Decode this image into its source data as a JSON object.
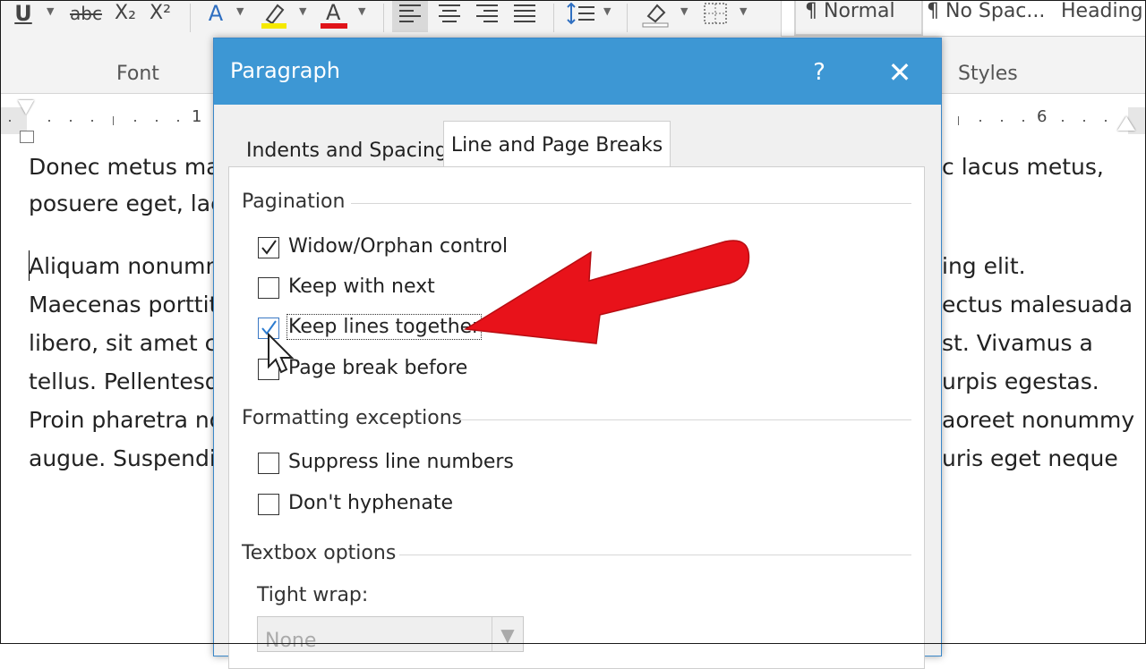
{
  "ribbon": {
    "font_group_label": "Font",
    "styles_group_label": "Styles",
    "font_tools": [
      "U",
      "abc",
      "X₂",
      "X²",
      "A",
      "A"
    ],
    "styles": [
      "¶ Normal",
      "¶ No Spac...",
      "Heading"
    ]
  },
  "ruler": {
    "labels": [
      "1",
      "6"
    ]
  },
  "document": {
    "lines": [
      "Donec metus mas",
      "posuere eget, laci",
      "Aliquam nonumm",
      "Maecenas porttit",
      "libero, sit amet c",
      "tellus. Pellentesqu",
      "Proin pharetra no",
      "augue. Suspendis"
    ],
    "right_lines": [
      "c lacus metus,",
      "ing elit.",
      "ectus malesuada",
      "st. Vivamus a",
      "urpis egestas.",
      "aoreet nonummy",
      "uris eget neque"
    ]
  },
  "dialog": {
    "title": "Paragraph",
    "help": "?",
    "close": "✕",
    "tabs": {
      "indents": "Indents and Spacing",
      "line_breaks": "Line and Page Breaks"
    },
    "pagination": {
      "label": "Pagination",
      "widow_orphan": "Widow/Orphan control",
      "widow_orphan_checked": true,
      "keep_with_next": "Keep with next",
      "keep_with_next_checked": false,
      "keep_lines_together": "Keep lines together",
      "keep_lines_together_checked": true,
      "page_break_before": "Page break before",
      "page_break_before_checked": false
    },
    "formatting_exceptions": {
      "label": "Formatting exceptions",
      "suppress_line_numbers": "Suppress line numbers",
      "suppress_checked": false,
      "dont_hyphenate": "Don't hyphenate",
      "dont_hyphenate_checked": false
    },
    "textbox_options": {
      "label": "Textbox options",
      "tight_wrap_label": "Tight wrap:",
      "tight_wrap_value": "None"
    }
  },
  "colors": {
    "titlebar": "#3d97d4",
    "annotation_arrow": "#e8121a",
    "checkmark": "#2b7bd0"
  }
}
